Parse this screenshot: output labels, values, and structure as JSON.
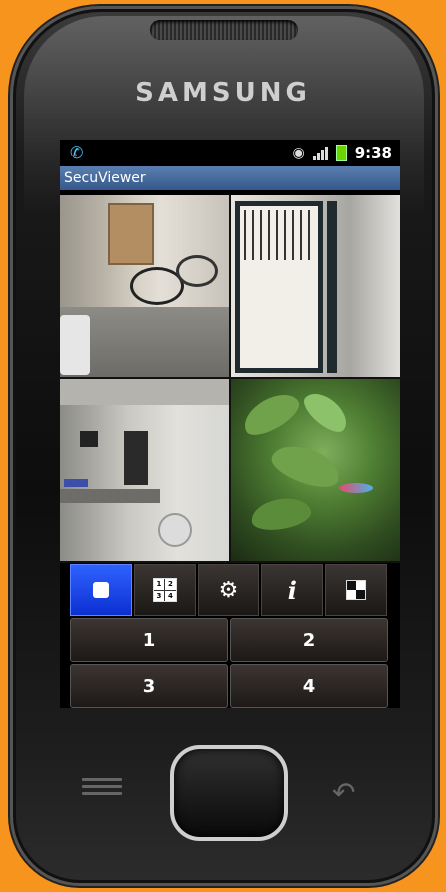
{
  "device": {
    "brand": "SAMSUNG"
  },
  "statusbar": {
    "time": "9:38",
    "notification_icon": "phone-call-icon",
    "wifi_icon": "wifi-icon",
    "signal_icon": "signal-icon",
    "battery_icon": "battery-icon"
  },
  "app": {
    "title": "SecuViewer"
  },
  "cameras": [
    {
      "id": "camera-1",
      "scene": "courtyard-bikes"
    },
    {
      "id": "camera-2",
      "scene": "door"
    },
    {
      "id": "camera-3",
      "scene": "workshop"
    },
    {
      "id": "camera-4",
      "scene": "aquarium"
    }
  ],
  "toolbar": {
    "buttons": [
      {
        "icon": "single-view-icon",
        "active": true
      },
      {
        "icon": "quad-grid-icon",
        "labels": [
          "1",
          "2",
          "3",
          "4"
        ],
        "active": false
      },
      {
        "icon": "gear-icon",
        "active": false
      },
      {
        "icon": "info-icon",
        "label": "i",
        "active": false
      },
      {
        "icon": "layout-icon",
        "active": false
      }
    ]
  },
  "channels": {
    "labels": [
      "1",
      "2",
      "3",
      "4"
    ]
  },
  "hardware": {
    "menu_icon": "menu-icon",
    "home_icon": "home-button",
    "back_icon": "back-icon"
  },
  "colors": {
    "background": "#f7941d",
    "active_button": "#1f4cf0",
    "title_bar": "#4a6fa0"
  }
}
